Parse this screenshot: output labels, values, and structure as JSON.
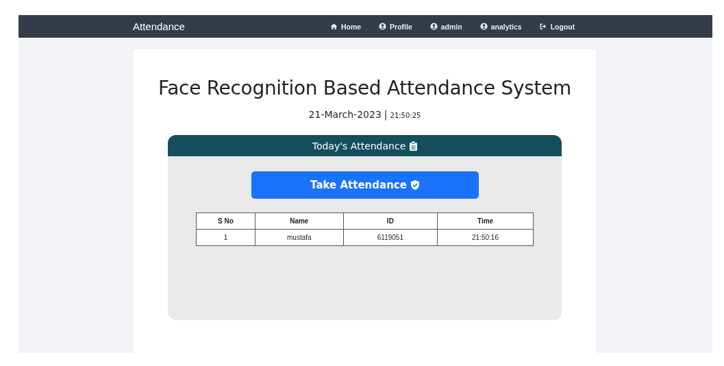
{
  "navbar": {
    "brand": "Attendance",
    "links": [
      {
        "kind": "home",
        "label": "Home"
      },
      {
        "kind": "user",
        "label": "Profile"
      },
      {
        "kind": "user",
        "label": "admin"
      },
      {
        "kind": "user",
        "label": "analytics"
      },
      {
        "kind": "logout",
        "label": "Logout"
      }
    ]
  },
  "page": {
    "title": "Face Recognition Based Attendance System",
    "date": "21-March-2023",
    "separator": "|",
    "time": "21:50:25"
  },
  "panel": {
    "title": "Today's Attendance",
    "button": "Take Attendance",
    "table": {
      "columns": [
        "S No",
        "Name",
        "ID",
        "Time"
      ],
      "rows": [
        [
          "1",
          "mustafa",
          "6119051",
          "21:50:16"
        ]
      ]
    }
  }
}
